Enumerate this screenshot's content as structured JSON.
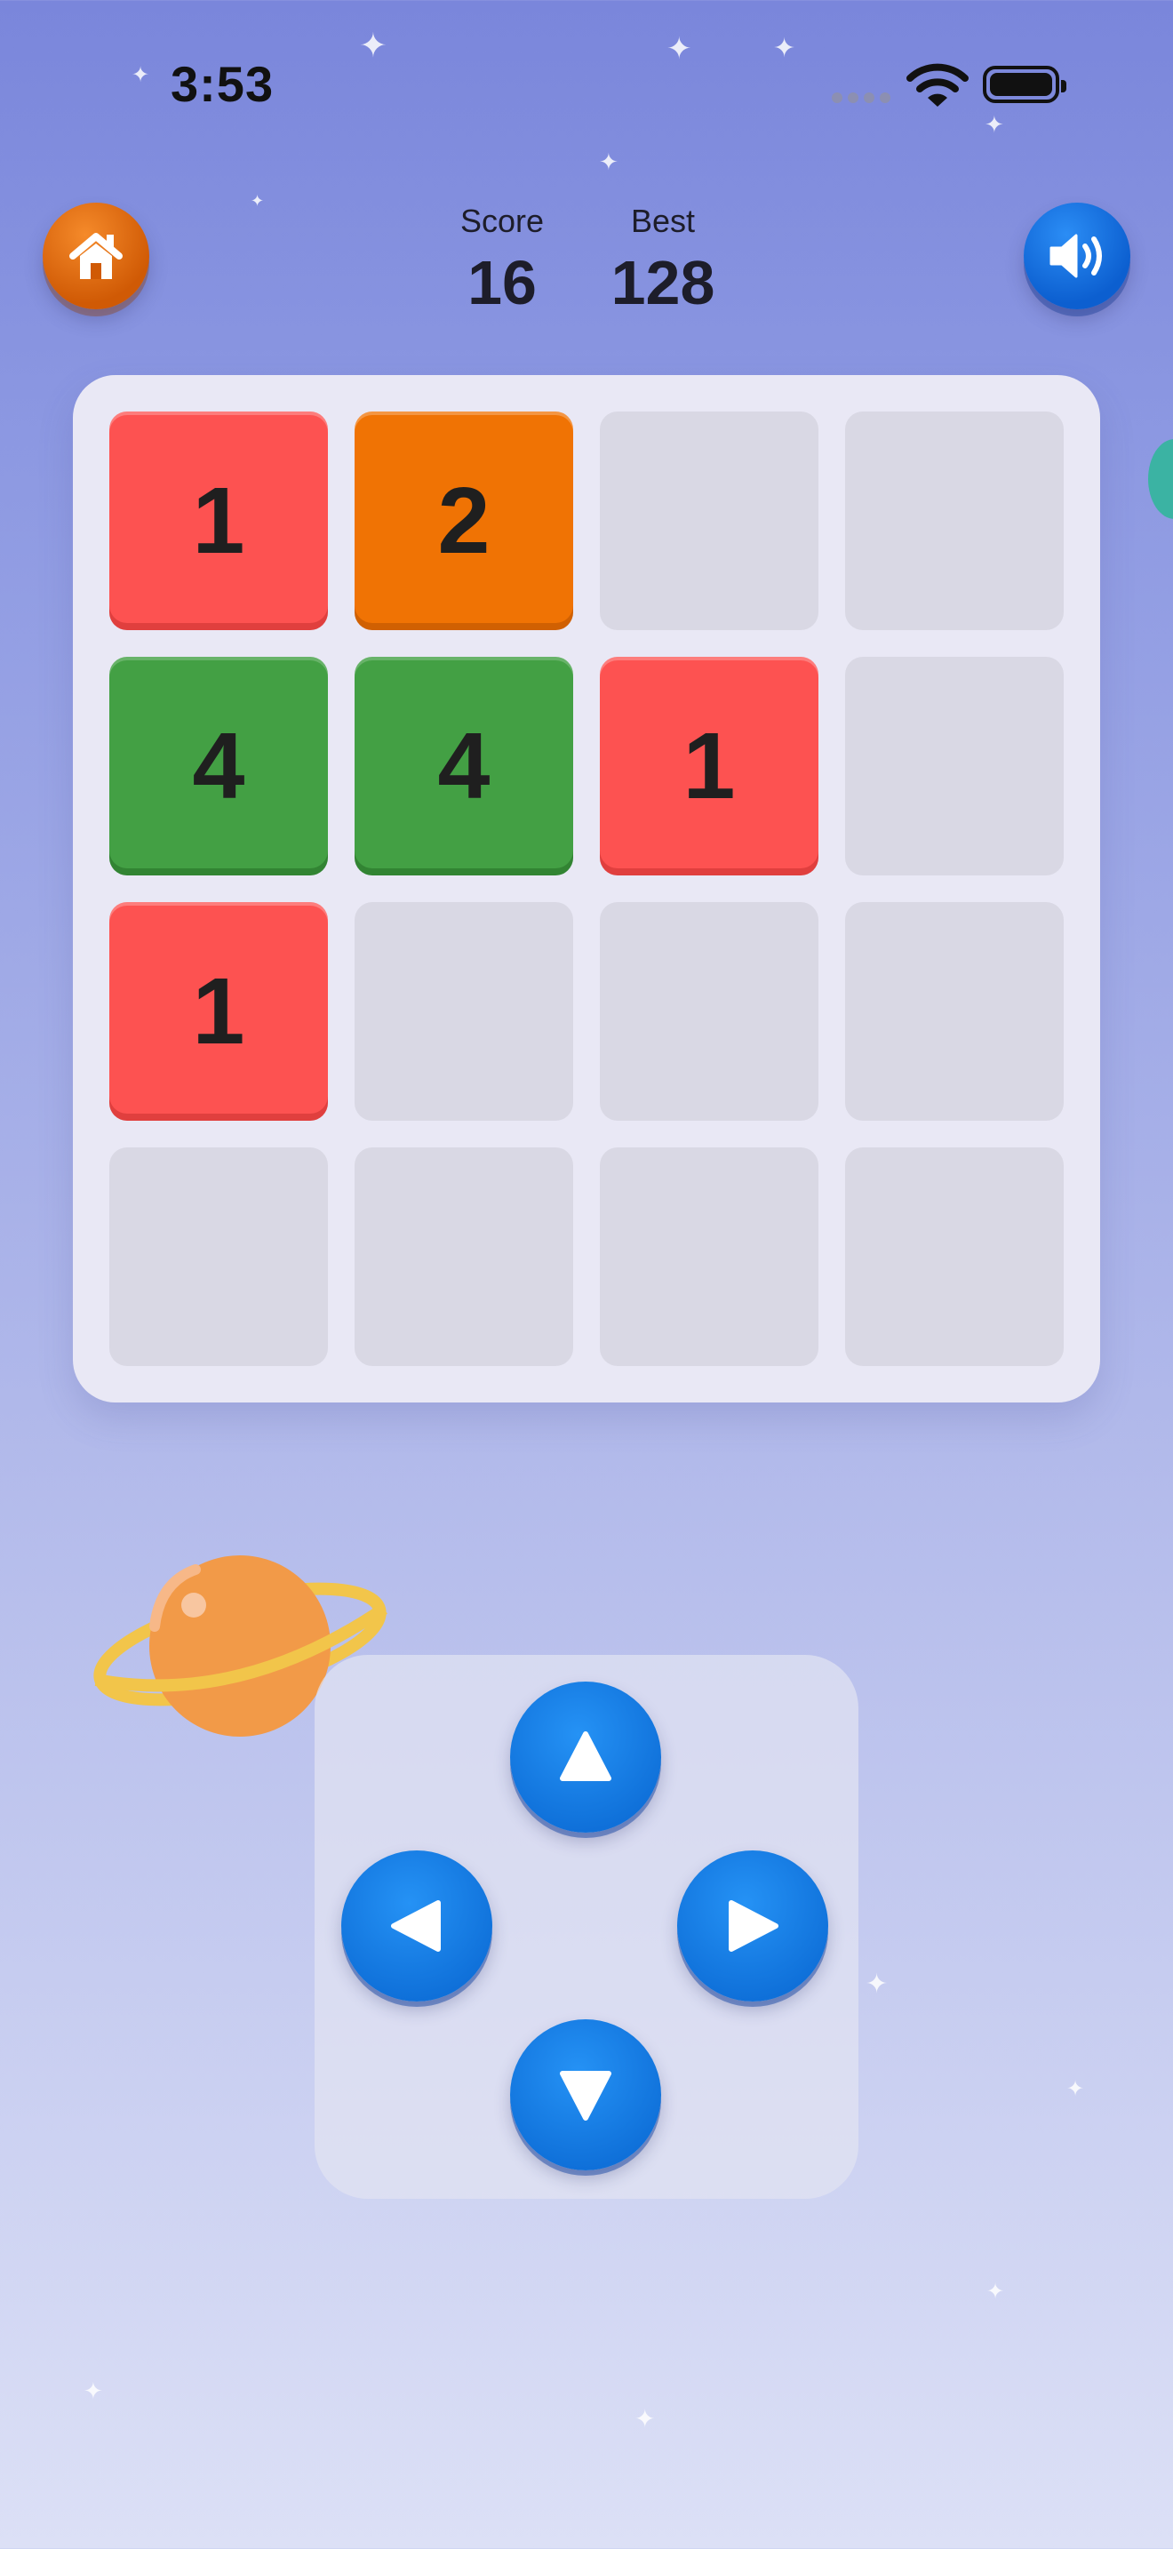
{
  "status_bar": {
    "time": "3:53",
    "icons": [
      "cellular-signal-icon",
      "wifi-icon",
      "battery-icon"
    ]
  },
  "header": {
    "home_icon": "home-icon",
    "sound_icon": "speaker-icon",
    "score_label": "Score",
    "score_value": "16",
    "best_label": "Best",
    "best_value": "128"
  },
  "board": {
    "rows": [
      [
        "1",
        "2",
        "",
        ""
      ],
      [
        "4",
        "4",
        "1",
        ""
      ],
      [
        "1",
        "",
        "",
        ""
      ],
      [
        "",
        "",
        "",
        ""
      ]
    ],
    "tile_colors": {
      "1": "#fd5251",
      "2": "#f07304",
      "4": "#43a044"
    },
    "empty_color": "#d9d8e4"
  },
  "controls": {
    "up_icon": "arrow-up-icon",
    "left_icon": "arrow-left-icon",
    "right_icon": "arrow-right-icon",
    "down_icon": "arrow-down-icon"
  },
  "colors": {
    "accent_blue": "#0f70d9",
    "home_orange": "#d05a05",
    "background_top": "#7a86db",
    "background_bottom": "#dce0f6"
  }
}
